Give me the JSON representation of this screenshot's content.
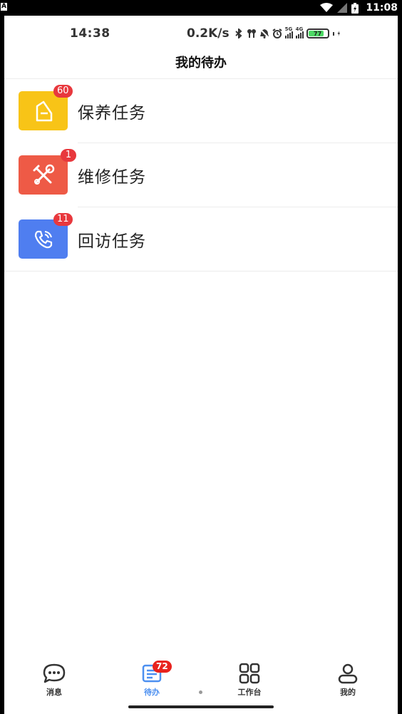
{
  "system_bar": {
    "indicator": "A",
    "time": "11:08",
    "icons": [
      "wifi-icon",
      "signal-icon",
      "battery-icon"
    ]
  },
  "inner_status": {
    "time": "14:38",
    "net_speed": "0.2K/s",
    "signal_1_tag": "5G",
    "signal_2_tag": "4G",
    "battery": "77",
    "icons": [
      "bluetooth-icon",
      "earbuds-icon",
      "mute-icon",
      "alarm-icon",
      "signal-5g-icon",
      "signal-4g-icon",
      "battery-icon",
      "charging-icon"
    ]
  },
  "header": {
    "title": "我的待办"
  },
  "tasks": [
    {
      "label": "保养任务",
      "badge": "60",
      "color": "#f8c417",
      "icon": "document-icon"
    },
    {
      "label": "维修任务",
      "badge": "1",
      "color": "#ee5a46",
      "icon": "tools-icon"
    },
    {
      "label": "回访任务",
      "badge": "11",
      "color": "#4f7ef0",
      "icon": "phone-icon"
    }
  ],
  "tabbar": {
    "active_color": "#4b8ff0",
    "tabs": [
      {
        "label": "消息",
        "icon": "chat-icon"
      },
      {
        "label": "待办",
        "icon": "todo-list-icon",
        "badge": "72",
        "active": true
      },
      {
        "label": "工作台",
        "icon": "grid-icon"
      },
      {
        "label": "我的",
        "icon": "profile-icon"
      }
    ]
  }
}
